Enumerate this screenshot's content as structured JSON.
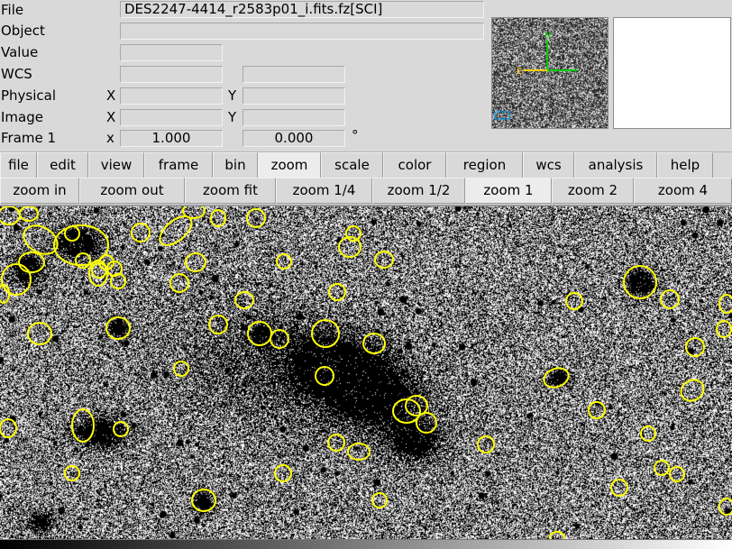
{
  "info_panel": {
    "file": {
      "label": "File",
      "value": "DES2247-4414_r2583p01_i.fits.fz[SCI]"
    },
    "object": {
      "label": "Object",
      "value": ""
    },
    "value": {
      "label": "Value",
      "value": ""
    },
    "wcs": {
      "label": "WCS",
      "value1": "",
      "value2": ""
    },
    "physical": {
      "label": "Physical",
      "x_label": "X",
      "y_label": "Y",
      "x": "",
      "y": ""
    },
    "image": {
      "label": "Image",
      "x_label": "X",
      "y_label": "Y",
      "x": "",
      "y": ""
    },
    "frame": {
      "label": "Frame 1",
      "x_label": "x",
      "zoom": "1.000",
      "angle": "0.000",
      "unit": "°"
    }
  },
  "panner": {
    "north_label": "N",
    "east_label": "E",
    "compass_color": "#00cc00",
    "east_color": "#ffcc00",
    "box_color": "#00a0ff"
  },
  "menubar": {
    "items": [
      {
        "label": "file"
      },
      {
        "label": "edit"
      },
      {
        "label": "view"
      },
      {
        "label": "frame"
      },
      {
        "label": "bin"
      },
      {
        "label": "zoom",
        "active": true
      },
      {
        "label": "scale"
      },
      {
        "label": "color"
      },
      {
        "label": "region"
      },
      {
        "label": "wcs"
      },
      {
        "label": "analysis"
      },
      {
        "label": "help"
      }
    ]
  },
  "buttonbar": {
    "items": [
      {
        "label": "zoom in"
      },
      {
        "label": "zoom out"
      },
      {
        "label": "zoom fit"
      },
      {
        "label": "zoom 1/4"
      },
      {
        "label": "zoom 1/2"
      },
      {
        "label": "zoom 1",
        "active": true
      },
      {
        "label": "zoom 2"
      },
      {
        "label": "zoom 4"
      }
    ]
  },
  "image_display": {
    "region_color": "#ffff00",
    "region_count": 70
  }
}
